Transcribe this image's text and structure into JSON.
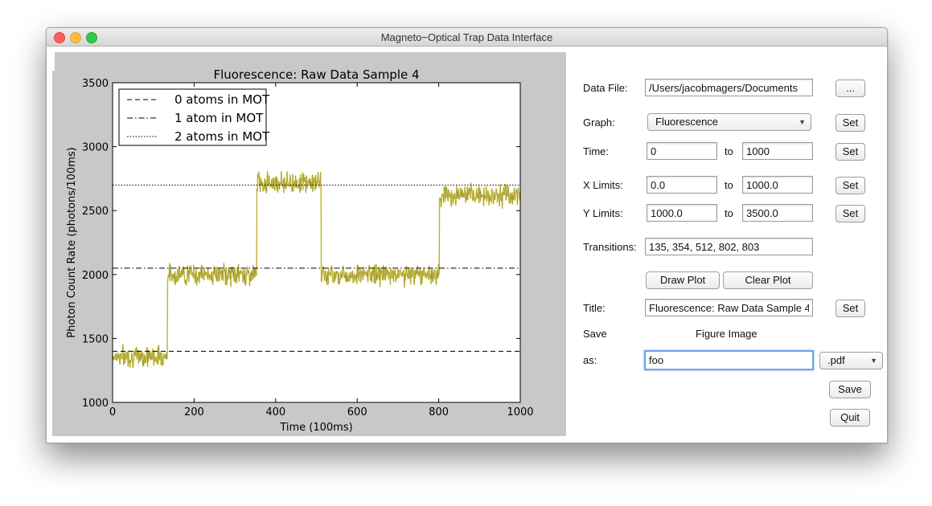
{
  "window": {
    "title": "Magneto−Optical Trap Data Interface"
  },
  "chart_data": {
    "type": "line",
    "title": "Fluorescence: Raw Data Sample 4",
    "xlabel": "Time (100ms)",
    "ylabel": "Photon Count Rate (photons/100ms)",
    "xlim": [
      0,
      1000
    ],
    "ylim": [
      1000,
      3500
    ],
    "xticks": [
      0,
      200,
      400,
      600,
      800,
      1000
    ],
    "yticks": [
      1000,
      1500,
      2000,
      2500,
      3000,
      3500
    ],
    "grid": false,
    "legend_position": "top-left",
    "reference_lines": [
      {
        "name": "0 atoms in MOT",
        "y": 1400,
        "style": "dashed",
        "sample": "– –"
      },
      {
        "name": "1 atom in MOT",
        "y": 2050,
        "style": "dashdot",
        "sample": "–·–"
      },
      {
        "name": "2 atoms in MOT",
        "y": 2700,
        "style": "dotted",
        "sample": "·····"
      }
    ],
    "series": [
      {
        "segments": [
          {
            "x": [
              0,
              135
            ],
            "level": 1360
          },
          {
            "x": [
              135,
              354
            ],
            "level": 2000
          },
          {
            "x": [
              354,
              512
            ],
            "level": 2720
          },
          {
            "x": [
              512,
              802
            ],
            "level": 2000
          },
          {
            "x": [
              802,
              1000
            ],
            "level": 2620
          }
        ],
        "color_line": "#c8c030",
        "color_fill": "#d8d04a"
      }
    ]
  },
  "controls": {
    "data_file": {
      "label": "Data File:",
      "value": "/Users/jacobmagers/Documents",
      "browse_label": "..."
    },
    "graph": {
      "label": "Graph:",
      "selected": "Fluorescence",
      "set_label": "Set"
    },
    "time": {
      "label": "Time:",
      "from": "0",
      "to_label": "to",
      "to": "1000",
      "set_label": "Set"
    },
    "xlimits": {
      "label": "X Limits:",
      "from": "0.0",
      "to_label": "to",
      "to": "1000.0",
      "set_label": "Set"
    },
    "ylimits": {
      "label": "Y Limits:",
      "from": "1000.0",
      "to_label": "to",
      "to": "3500.0",
      "set_label": "Set"
    },
    "transitions": {
      "label": "Transitions:",
      "value": "135, 354, 512, 802, 803"
    },
    "draw_plot_label": "Draw Plot",
    "clear_plot_label": "Clear Plot",
    "title": {
      "label": "Title:",
      "value": "Fluorescence: Raw Data Sample 4",
      "set_label": "Set"
    },
    "save_section": {
      "label": "Save",
      "subtitle": "Figure Image",
      "as_label": "as:",
      "filename": "foo",
      "format": ".pdf"
    },
    "save_label": "Save",
    "quit_label": "Quit"
  }
}
